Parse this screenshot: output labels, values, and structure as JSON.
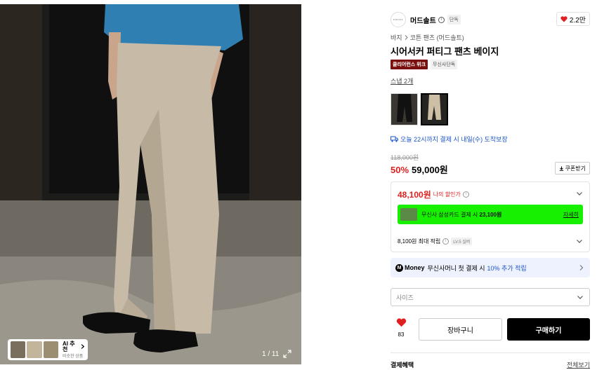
{
  "gallery": {
    "counter": "1 / 11",
    "ai_chip": {
      "title": "AI 추천",
      "subtitle": "비슷한 상품"
    }
  },
  "brand": {
    "name": "머드솔트",
    "exclusive_tag": "단독"
  },
  "like": {
    "count": "2.2만"
  },
  "breadcrumb": [
    "바지",
    "코튼 팬츠 (머드솔트)"
  ],
  "product": {
    "title": "시어서커 퍼티그 팬츠 베이지",
    "badges": {
      "week": "클리어런스 위크",
      "exclusive": "무신사단독"
    },
    "snap_link": "스냅 2개",
    "delivery": "오늘 22시까지 결제 시 내일(수) 도착보장",
    "original_price": "118,000원",
    "discount": "50%",
    "price": "59,000원",
    "coupon_label": "쿠폰받기"
  },
  "benefit_box": {
    "my_price": "48,100원",
    "my_price_label": "나의 할인가",
    "card": {
      "text": "무신사 삼성카드 결제 시",
      "amount": "23,100원",
      "detail": "자세히"
    },
    "points": {
      "text": "8,100원 최대 적립",
      "level": "LV.5 실버"
    }
  },
  "money_banner": {
    "icon": "M",
    "brand": "Money",
    "text": "무신사머니 첫 결제 시",
    "highlight": "10% 추가 적립"
  },
  "size_select": {
    "placeholder": "사이즈"
  },
  "actions": {
    "wish_count": "83",
    "cart_label": "장바구니",
    "buy_label": "구매하기"
  },
  "payment": {
    "title": "결제혜택",
    "view_all": "전체보기"
  },
  "colors": {
    "discount_red": "#e02020",
    "card_banner": "#17f000",
    "link_blue": "#1a55c7",
    "badge_red": "#7a1010"
  }
}
